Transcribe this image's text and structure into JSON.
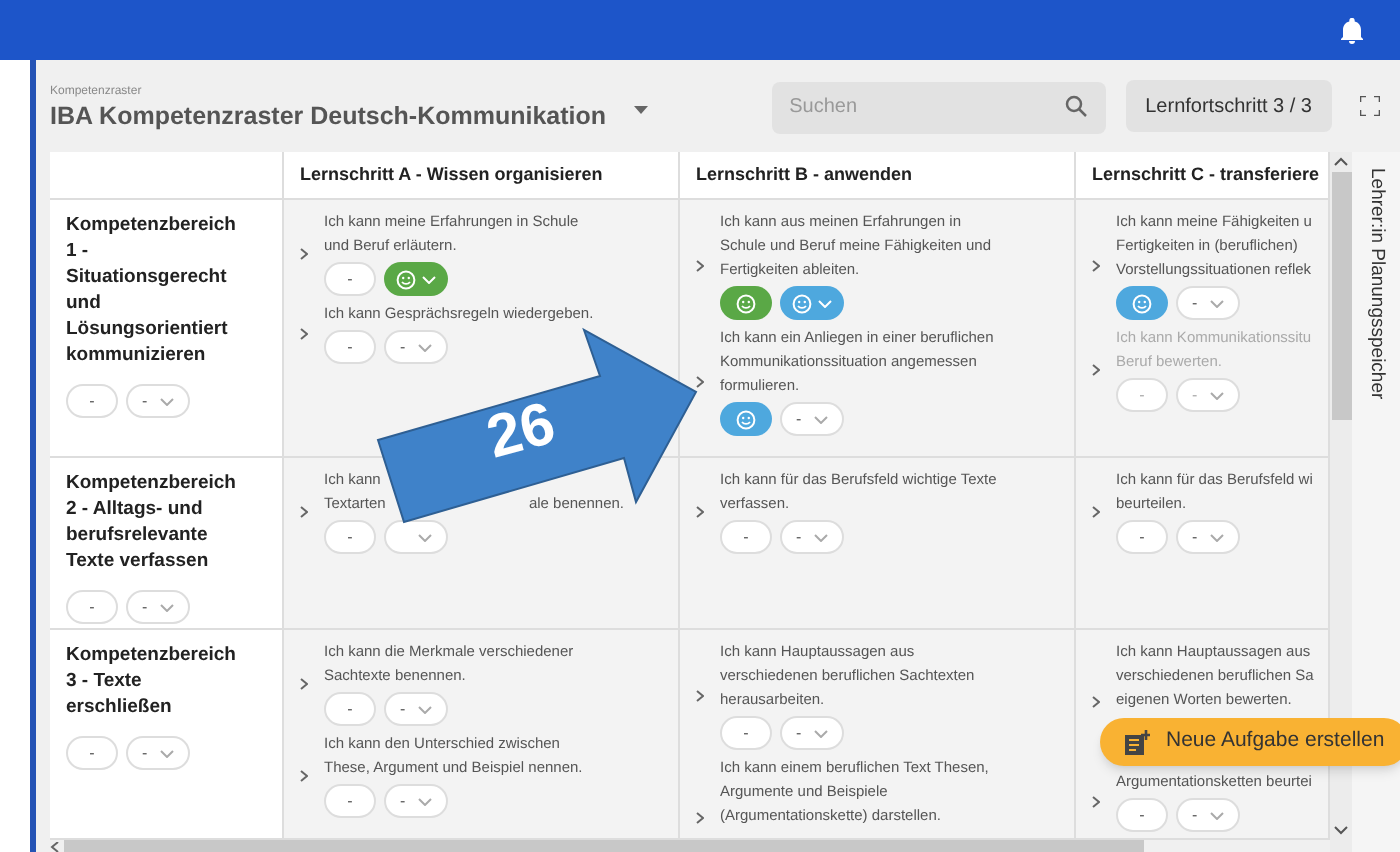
{
  "header": {
    "label": "Kompetenzraster",
    "title": "IBA Kompetenzraster Deutsch-Kommunikation",
    "search": {
      "placeholder": "Suchen"
    },
    "progress_button": "Lernfortschritt 3 / 3"
  },
  "table": {
    "columns": [
      "Lernschritt A - Wissen organisieren",
      "Lernschritt B - anwenden",
      "Lernschritt C - transferiere"
    ],
    "rows": [
      {
        "heading": "Kompetenzbereich 1 - Situationsgerecht und Lösungsorientiert kommunizieren",
        "controls": [
          {
            "kind": "empty",
            "text": "-"
          },
          {
            "kind": "select",
            "text": "-"
          }
        ],
        "cells": [
          [
            {
              "disabled": false,
              "lines": [
                "Ich kann meine Erfahrungen in Schule",
                "und Beruf erläutern."
              ],
              "controls": [
                {
                  "kind": "empty",
                  "text": "-"
                },
                {
                  "kind": "face_select",
                  "color": "#5aa846"
                }
              ]
            },
            {
              "disabled": false,
              "lines": [
                "Ich kann Gesprächsregeln wiedergeben."
              ],
              "controls": [
                {
                  "kind": "empty",
                  "text": "-"
                },
                {
                  "kind": "select",
                  "text": "-"
                }
              ]
            }
          ],
          [
            {
              "disabled": false,
              "lines": [
                "Ich kann aus meinen Erfahrungen in",
                "Schule und Beruf meine Fähigkeiten und",
                "Fertigkeiten ableiten."
              ],
              "controls": [
                {
                  "kind": "face",
                  "color": "#5aa846"
                },
                {
                  "kind": "face_select",
                  "color": "#4ea8de"
                }
              ]
            },
            {
              "disabled": false,
              "lines": [
                "Ich kann ein Anliegen in einer beruflichen",
                "Kommunikationssituation angemessen",
                "formulieren."
              ],
              "controls": [
                {
                  "kind": "face",
                  "color": "#4ea8de"
                },
                {
                  "kind": "select",
                  "text": "-"
                }
              ]
            }
          ],
          [
            {
              "disabled": false,
              "lines": [
                "Ich kann meine Fähigkeiten u",
                "Fertigkeiten in (beruflichen)",
                "Vorstellungssituationen reflek"
              ],
              "controls": [
                {
                  "kind": "face",
                  "color": "#4ea8de"
                },
                {
                  "kind": "select",
                  "text": "-"
                }
              ]
            },
            {
              "disabled": true,
              "lines": [
                "Ich kann Kommunikationssitu",
                "Beruf bewerten."
              ],
              "controls": [
                {
                  "kind": "empty",
                  "text": "-"
                },
                {
                  "kind": "select",
                  "text": "-"
                }
              ]
            }
          ]
        ]
      },
      {
        "heading": "Kompetenzbereich 2 - Alltags- und berufsrelevante Texte verfassen",
        "controls": [
          {
            "kind": "empty",
            "text": "-"
          },
          {
            "kind": "select",
            "text": "-"
          }
        ],
        "cells": [
          [
            {
              "disabled": false,
              "lines": [
                "Ich kann",
                [
                  "Textarten",
                  "ale benennen."
                ]
              ],
              "controls": [
                {
                  "kind": "empty",
                  "text": "-"
                },
                {
                  "kind": "select"
                }
              ]
            }
          ],
          [
            {
              "disabled": false,
              "lines": [
                "Ich kann für das Berufsfeld wichtige Texte",
                "verfassen."
              ],
              "controls": [
                {
                  "kind": "empty",
                  "text": "-"
                },
                {
                  "kind": "select",
                  "text": "-"
                }
              ]
            }
          ],
          [
            {
              "disabled": false,
              "lines": [
                "Ich kann für das Berufsfeld wi",
                "beurteilen."
              ],
              "controls": [
                {
                  "kind": "empty",
                  "text": "-"
                },
                {
                  "kind": "select",
                  "text": "-"
                }
              ]
            }
          ]
        ]
      },
      {
        "heading": "Kompetenzbereich 3 - Texte erschließen",
        "controls": [
          {
            "kind": "empty",
            "text": "-"
          },
          {
            "kind": "select",
            "text": "-"
          }
        ],
        "cells": [
          [
            {
              "disabled": false,
              "lines": [
                "Ich kann die Merkmale verschiedener",
                "Sachtexte benennen."
              ],
              "controls": [
                {
                  "kind": "empty",
                  "text": "-"
                },
                {
                  "kind": "select",
                  "text": "-"
                }
              ]
            },
            {
              "disabled": false,
              "lines": [
                "Ich kann den Unterschied zwischen",
                "These, Argument und Beispiel nennen."
              ],
              "controls": [
                {
                  "kind": "empty",
                  "text": "-"
                },
                {
                  "kind": "select",
                  "text": "-"
                }
              ]
            }
          ],
          [
            {
              "disabled": false,
              "lines": [
                "Ich kann Hauptaussagen aus",
                "verschiedenen beruflichen Sachtexten",
                "herausarbeiten."
              ],
              "controls": [
                {
                  "kind": "empty",
                  "text": "-"
                },
                {
                  "kind": "select",
                  "text": "-"
                }
              ]
            },
            {
              "disabled": false,
              "lines": [
                "Ich kann einem beruflichen Text Thesen,",
                "Argumente und Beispiele",
                "(Argumentationskette) darstellen."
              ]
            }
          ],
          [
            {
              "disabled": false,
              "lines": [
                "Ich kann Hauptaussagen aus",
                "verschiedenen beruflichen Sa",
                "eigenen Worten bewerten."
              ]
            },
            {
              "disabled": false,
              "lines": [
                "Argumentationsketten beurtei"
              ],
              "controls": [
                {
                  "kind": "empty",
                  "text": "-"
                },
                {
                  "kind": "select",
                  "text": "-"
                }
              ]
            }
          ]
        ]
      }
    ]
  },
  "side_tab": "Lehrer:in Planungsspeicher",
  "fab": "Neue Aufgabe erstellen",
  "annotation": {
    "label": "26"
  }
}
